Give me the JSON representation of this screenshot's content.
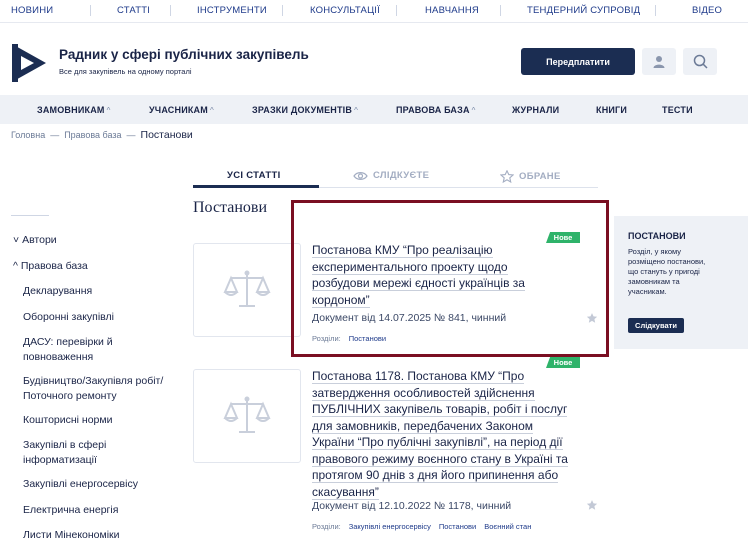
{
  "top_nav": [
    "НОВИНИ",
    "СТАТТІ",
    "ІНСТРУМЕНТИ",
    "КОНСУЛЬТАЦІЇ",
    "НАВЧАННЯ",
    "ТЕНДЕРНИЙ СУПРОВІД",
    "ВІДЕО"
  ],
  "brand": {
    "title": "Радник у сфері публічних закупівель",
    "subtitle": "Все для закупівель на одному порталі"
  },
  "header": {
    "subscribe_label": "Передплатити",
    "user_icon": "user-icon",
    "search_icon": "search-icon"
  },
  "main_nav": [
    {
      "label": "ЗАМОВНИКАМ",
      "chevron": "^"
    },
    {
      "label": "УЧАСНИКАМ",
      "chevron": "^"
    },
    {
      "label": "ЗРАЗКИ ДОКУМЕНТІВ",
      "chevron": "^"
    },
    {
      "label": "ПРАВОВА БАЗА",
      "chevron": "^"
    },
    {
      "label": "ЖУРНАЛИ",
      "chevron": ""
    },
    {
      "label": "КНИГИ",
      "chevron": ""
    },
    {
      "label": "ТЕСТИ",
      "chevron": ""
    }
  ],
  "breadcrumb": {
    "home": "Головна",
    "section": "Правова база",
    "current": "Постанови",
    "separator": "—"
  },
  "tabs": [
    {
      "label": "УСІ СТАТТІ",
      "icon": "",
      "active": true
    },
    {
      "label": "СЛІДКУЄТЕ",
      "icon": "eye-icon",
      "active": false
    },
    {
      "label": "ОБРАНЕ",
      "icon": "star-icon",
      "active": false
    }
  ],
  "page_title": "Постанови",
  "sidebar": [
    {
      "label": "Автори",
      "chevron": "˅"
    },
    {
      "label": "Правова база",
      "chevron": "^"
    },
    {
      "label": "Декларування"
    },
    {
      "label": "Оборонні закупівлі"
    },
    {
      "label": "ДАСУ: перевірки й",
      "label2": "повноваження"
    },
    {
      "label": "Будівництво/Закупівля робіт/",
      "label2": "Поточного ремонту"
    },
    {
      "label": "Кошторисні норми"
    },
    {
      "label": "Закупівлі в сфері",
      "label2": "інформатизації"
    },
    {
      "label": "Закупівлі енергосервісу"
    },
    {
      "label": "Електрична енергія"
    },
    {
      "label": "Листи Мінекономіки"
    }
  ],
  "articles": [
    {
      "badge": "Нове",
      "title_lines": [
        "Постанова КМУ “Про реалізацію",
        "експериментального проекту щодо",
        "розбудови мережі єдності українців за",
        "кордоном”"
      ],
      "meta": "Документ від 14.07.2025 № 841, чинний",
      "sections_label": "Розділи:",
      "tags": [
        "Постанови"
      ]
    },
    {
      "badge": "Нове",
      "title_lines": [
        "Постанова 1178. Постанова КМУ “Про",
        "затвердження особливостей здійснення",
        "ПУБЛІЧНИХ закупівель товарів, робіт і послуг",
        "для замовників, передбачених Законом",
        "України “Про публічні закупівлі”, на період дії",
        "правового режиму воєнного стану в Україні та",
        "протягом 90 днів з дня його припинення або",
        "скасування”"
      ],
      "meta": "Документ від 12.10.2022 № 1178, чинний",
      "sections_label": "Розділи:",
      "tags": [
        "Закупівлі енергосервісу",
        "Постанови",
        "Воєнний стан"
      ]
    }
  ],
  "promo": {
    "title": "ПОСТАНОВИ",
    "text": "Розділ, у якому розміщено постанови, що стануть у пригоді замовникам та учасникам.",
    "button": "Слідкувати"
  },
  "colors": {
    "brand_navy": "#1b2d52",
    "badge_green": "#2fb36a",
    "highlight": "#7a0f22"
  }
}
